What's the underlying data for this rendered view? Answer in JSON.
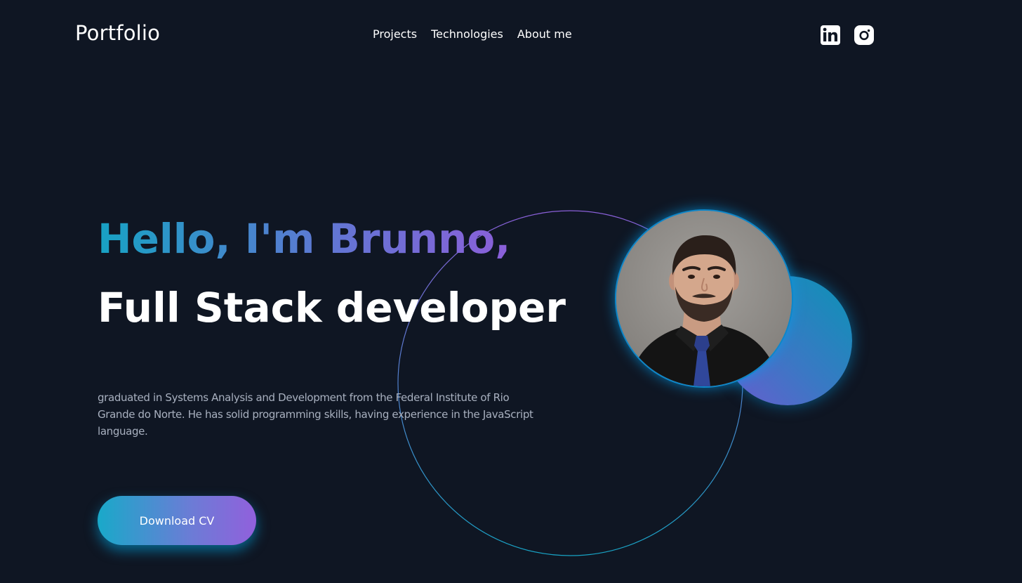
{
  "header": {
    "logo": "Portfolio",
    "nav": [
      {
        "label": "Projects"
      },
      {
        "label": "Technologies"
      },
      {
        "label": "About me"
      }
    ],
    "social": [
      {
        "icon": "linkedin-icon"
      },
      {
        "icon": "instagram-icon"
      }
    ]
  },
  "hero": {
    "greeting": "Hello, I'm Brunno,",
    "role": "Full Stack developer",
    "description": "graduated in Systems Analysis and Development from the Federal Institute of Rio Grande do Norte. He has solid programming skills, having experience in the JavaScript language.",
    "cta_label": "Download CV"
  },
  "colors": {
    "background": "#0f1623",
    "accent_start": "#17a2c3",
    "accent_end": "#8b5fd9",
    "glow": "#00a0f0"
  }
}
